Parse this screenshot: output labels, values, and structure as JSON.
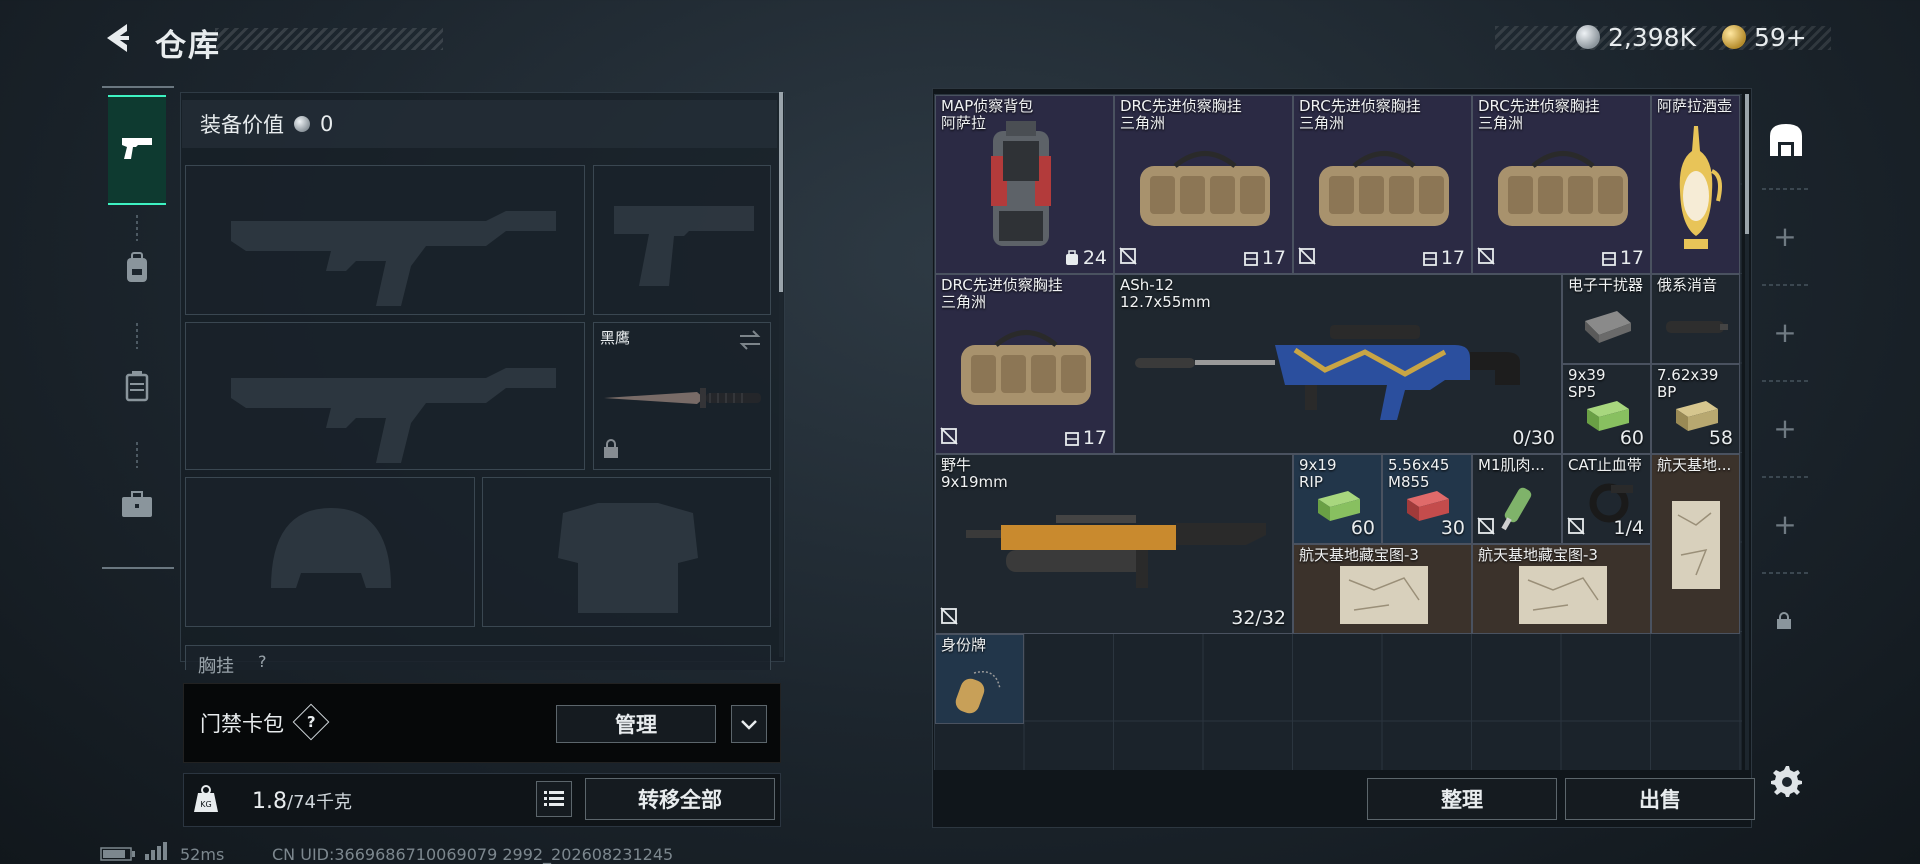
{
  "header": {
    "title": "仓库",
    "currency_silver": "2,398K",
    "currency_gold": "59+"
  },
  "sidebar": {
    "tabs": [
      {
        "name": "weapons",
        "icon": "pistol-icon",
        "active": true
      },
      {
        "name": "backpack",
        "icon": "backpack-icon",
        "active": false
      },
      {
        "name": "chest-rig",
        "icon": "chest-rig-icon",
        "active": false
      },
      {
        "name": "case",
        "icon": "briefcase-icon",
        "active": false
      }
    ]
  },
  "equipment": {
    "value_label": "装备价值",
    "value": "0",
    "melee_name": "黑鹰",
    "chest_rig_label": "胸挂",
    "chest_rig_mark": "?"
  },
  "keycard": {
    "label": "门禁卡包",
    "help": "?",
    "manage_button": "管理"
  },
  "weight": {
    "current": "1.8",
    "max": "/74千克",
    "transfer_all_button": "转移全部"
  },
  "inventory": {
    "items": [
      {
        "name": "MAP侦察背包",
        "sub": "阿萨拉",
        "count": "24"
      },
      {
        "name": "DRC先进侦察胸挂",
        "sub": "三角洲",
        "count": "17"
      },
      {
        "name": "DRC先进侦察胸挂",
        "sub": "三角洲",
        "count": "17"
      },
      {
        "name": "DRC先进侦察胸挂",
        "sub": "三角洲",
        "count": "17"
      },
      {
        "name": "阿萨拉酒壶",
        "sub": ""
      },
      {
        "name": "DRC先进侦察胸挂",
        "sub": "三角洲",
        "count": "17"
      },
      {
        "name": "ASh-12",
        "sub": "12.7x55mm",
        "count": "0/30"
      },
      {
        "name": "电子干扰器",
        "sub": ""
      },
      {
        "name": "俄系消音",
        "sub": ""
      },
      {
        "name": "9x39",
        "sub": "SP5",
        "count": "60"
      },
      {
        "name": "7.62x39",
        "sub": "BP",
        "count": "58"
      },
      {
        "name": "野牛",
        "sub": "9x19mm",
        "count": "32/32"
      },
      {
        "name": "9x19",
        "sub": "RIP",
        "count": "60"
      },
      {
        "name": "5.56x45",
        "sub": "M855",
        "count": "30"
      },
      {
        "name": "M1肌肉...",
        "sub": ""
      },
      {
        "name": "CAT止血带",
        "sub": "",
        "count": "1/4"
      },
      {
        "name": "航天基地...",
        "sub": ""
      },
      {
        "name": "航天基地藏宝图-3",
        "sub": ""
      },
      {
        "name": "航天基地藏宝图-3",
        "sub": ""
      },
      {
        "name": "身份牌",
        "sub": ""
      }
    ],
    "sort_button": "整理",
    "sell_button": "出售"
  },
  "status": {
    "ping": "52ms",
    "uid": "CN UID:3669686710069079 2992_202608231245"
  },
  "colors": {
    "accent": "#3ef2c2",
    "tile_purple": "#2b2a44",
    "tile_blue": "#22364a",
    "tile_brown": "#3b322b"
  }
}
